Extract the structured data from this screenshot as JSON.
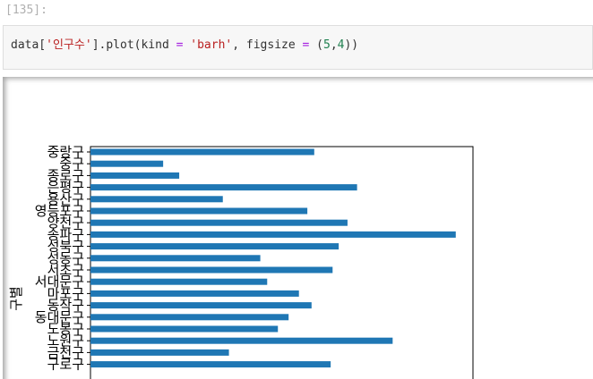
{
  "cell": {
    "prompt": "[135]:",
    "code_parts": {
      "p1": "data[",
      "p2": "'인구수'",
      "p3": "].plot(kind ",
      "p4": "=",
      "p5": " ",
      "p6": "'barh'",
      "p7": ", figsize ",
      "p8": "=",
      "p9": " (",
      "p10": "5",
      "p11": ",",
      "p12": "4",
      "p13": "))"
    }
  },
  "colors": {
    "bar": "#1f77b4",
    "axis": "#000000"
  },
  "chart_data": {
    "type": "bar",
    "orientation": "horizontal",
    "ylabel": "구별",
    "categories": [
      "중랑구",
      "중구",
      "종로구",
      "은평구",
      "용산구",
      "영등포구",
      "양천구",
      "송파구",
      "성북구",
      "성동구",
      "서초구",
      "서대문구",
      "마포구",
      "동작구",
      "동대문구",
      "도봉구",
      "노원구",
      "금천구",
      "구로구"
    ],
    "values": [
      585,
      190,
      232,
      697,
      346,
      567,
      672,
      955,
      649,
      444,
      633,
      462,
      545,
      578,
      518,
      490,
      790,
      362,
      628
    ],
    "xlim": [
      0,
      1000
    ],
    "visible_tick_labels": [
      "중랑구",
      "중구",
      "종로구",
      "은평구",
      "용산구",
      "영등포구",
      "양천구",
      "송파구",
      "성북구",
      "성동구",
      "서초구",
      "서대문구",
      "마포구",
      "동작구",
      "동대문구",
      "도봉구",
      "노원구",
      "금천구",
      "구로구"
    ]
  }
}
